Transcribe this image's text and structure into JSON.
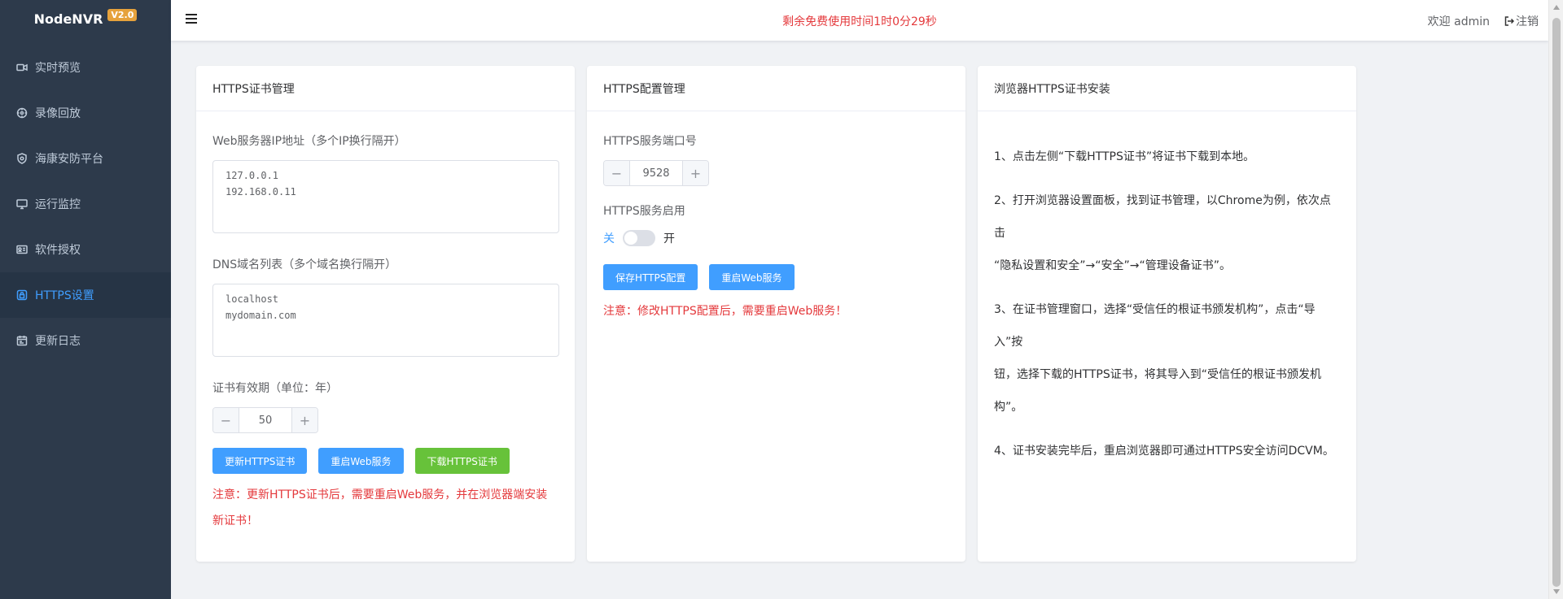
{
  "app": {
    "name": "NodeNVR",
    "version": "V2.0"
  },
  "sidebar": {
    "items": [
      {
        "label": "实时预览",
        "icon": "video-camera-icon"
      },
      {
        "label": "录像回放",
        "icon": "playback-icon"
      },
      {
        "label": "海康安防平台",
        "icon": "shield-icon"
      },
      {
        "label": "运行监控",
        "icon": "monitor-icon"
      },
      {
        "label": "软件授权",
        "icon": "license-card-icon"
      },
      {
        "label": "HTTPS设置",
        "icon": "lock-icon",
        "active": true
      },
      {
        "label": "更新日志",
        "icon": "calendar-icon"
      }
    ]
  },
  "header": {
    "trial_text": "剩余免费使用时间1时0分29秒",
    "welcome": "欢迎 admin",
    "logout": "注销"
  },
  "cert_card": {
    "title": "HTTPS证书管理",
    "ip_label": "Web服务器IP地址（多个IP换行隔开）",
    "ip_value": "127.0.0.1\n192.168.0.11",
    "dns_label": "DNS域名列表（多个域名换行隔开）",
    "dns_value": "localhost\nmydomain.com",
    "validity_label": "证书有效期（单位：年）",
    "validity_value": "50",
    "btn_update": "更新HTTPS证书",
    "btn_restart": "重启Web服务",
    "btn_download": "下载HTTPS证书",
    "warning": "注意：更新HTTPS证书后，需要重启Web服务，并在浏览器端安装新证书！"
  },
  "config_card": {
    "title": "HTTPS配置管理",
    "port_label": "HTTPS服务端口号",
    "port_value": "9528",
    "enable_label": "HTTPS服务启用",
    "switch_off": "关",
    "switch_on": "开",
    "switch_state": false,
    "btn_save": "保存HTTPS配置",
    "btn_restart": "重启Web服务",
    "warning": "注意：修改HTTPS配置后，需要重启Web服务！"
  },
  "install_card": {
    "title": "浏览器HTTPS证书安装",
    "step1": "1、点击左侧“下载HTTPS证书”将证书下载到本地。",
    "step2a": "2、打开浏览器设置面板，找到证书管理，以Chrome为例，依次点击",
    "step2b": "“隐私设置和安全”→“安全”→“管理设备证书”。",
    "step3a": "3、在证书管理窗口，选择“受信任的根证书颁发机构”，点击“导入”按",
    "step3b": "钮，选择下载的HTTPS证书，将其导入到“受信任的根证书颁发机",
    "step3c": "构”。",
    "step4": "4、证书安装完毕后，重启浏览器即可通过HTTPS安全访问DCVM。"
  }
}
